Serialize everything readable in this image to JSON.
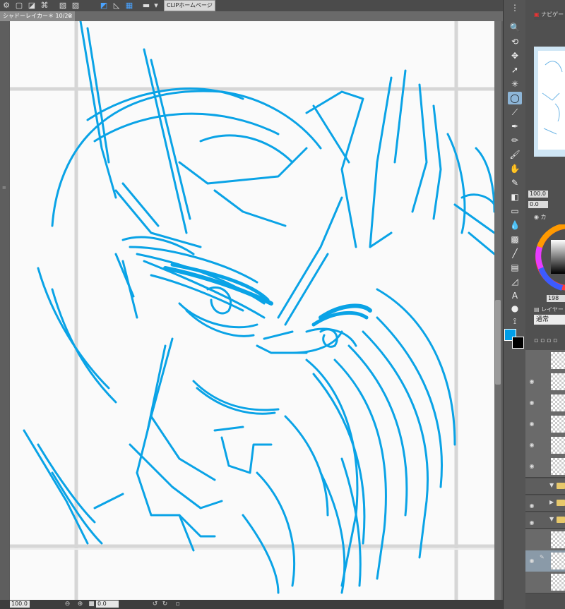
{
  "toolbar": {
    "clip_home": "CLIPホームページ"
  },
  "document": {
    "tab_title": "シャドーレイカー＊ 10/20",
    "tab_close": "×"
  },
  "status": {
    "zoom": "100.0",
    "angle": "0.0"
  },
  "panels": {
    "navigator_label": "ナビゲー",
    "brush_size": "100.0",
    "opacity": "0.0",
    "color_tab": "カ",
    "layer_tab": "レイヤー",
    "blend_mode": "通常",
    "value_readout": "198"
  },
  "colors": {
    "main": "#009ee8",
    "sub": "#000000",
    "stroke": "#0aa3e6"
  },
  "icons": {
    "tools": [
      "zoom-icon",
      "rotate-icon",
      "move-layer-icon",
      "select-arrow-icon",
      "auto-select-icon",
      "lasso-select-icon",
      "eyedropper-icon",
      "pen-icon",
      "pencil-icon",
      "brush-icon",
      "airbrush-icon",
      "decoration-icon",
      "eraser-icon",
      "blend-icon",
      "fill-icon",
      "gradient-icon",
      "figure-icon",
      "frame-icon",
      "ruler-icon",
      "text-icon",
      "balloon-icon",
      "correction-icon"
    ]
  }
}
